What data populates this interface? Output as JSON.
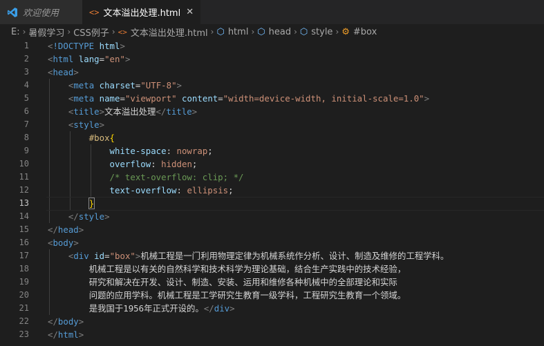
{
  "tabs": [
    {
      "label": "欢迎使用",
      "icon": "vscode-logo-icon",
      "active": false
    },
    {
      "label": "文本溢出处理.html",
      "icon": "html-file-icon",
      "active": true
    }
  ],
  "breadcrumb": [
    "E:",
    "暑假学习",
    "CSS例子",
    "文本溢出处理.html",
    "html",
    "head",
    "style",
    "#box"
  ],
  "editor": {
    "line_numbers": [
      "1",
      "2",
      "3",
      "4",
      "5",
      "6",
      "7",
      "8",
      "9",
      "10",
      "11",
      "12",
      "13",
      "14",
      "15",
      "16",
      "17",
      "18",
      "19",
      "20",
      "21",
      "22",
      "23"
    ],
    "current_line": 13
  },
  "code_text": {
    "l17": "机械工程是一门利用物理定律为机械系统作分析、设计、制造及维修的工程学科。",
    "l18": "机械工程是以有关的自然科学和技术科学为理论基础，结合生产实践中的技术经验，",
    "l19": "研究和解决在开发、设计、制造、安装、运用和维修各种机械中的全部理论和实际",
    "l20": "问题的应用学科。机械工程是工学研究生教育一级学科，工程研究生教育一个领域。",
    "l21": "是我国于1956年正式开设的。"
  },
  "colors": {
    "background": "#1e1e1e",
    "tag": "#569cd6",
    "attribute": "#9cdcfe",
    "string": "#ce9178",
    "selector": "#d7ba7d",
    "comment": "#6a9955"
  }
}
